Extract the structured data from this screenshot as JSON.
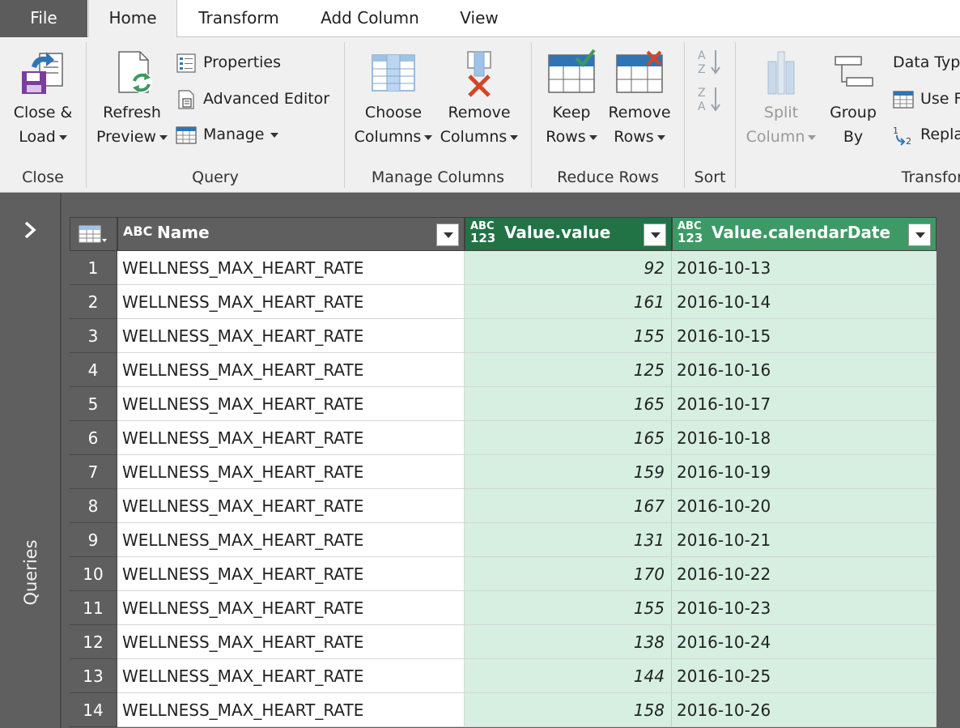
{
  "tabs": [
    "File",
    "Home",
    "Transform",
    "Add Column",
    "View"
  ],
  "ribbon": {
    "close_group": {
      "label": "Close",
      "close_load": [
        "Close &",
        "Load"
      ]
    },
    "query_group": {
      "label": "Query",
      "refresh": [
        "Refresh",
        "Preview"
      ],
      "properties": "Properties",
      "advanced_editor": "Advanced Editor",
      "manage": "Manage"
    },
    "manage_columns_group": {
      "label": "Manage Columns",
      "choose": [
        "Choose",
        "Columns"
      ],
      "remove": [
        "Remove",
        "Columns"
      ]
    },
    "reduce_rows_group": {
      "label": "Reduce Rows",
      "keep": [
        "Keep",
        "Rows"
      ],
      "remove": [
        "Remove",
        "Rows"
      ]
    },
    "sort_group": {
      "label": "Sort"
    },
    "transform_group": {
      "label": "Transfor",
      "split": [
        "Split",
        "Column"
      ],
      "group_by": [
        "Group",
        "By"
      ],
      "data_type": "Data Typ",
      "use_first_row": "Use F",
      "replace": "Repla"
    }
  },
  "queries_pane": {
    "label": "Queries"
  },
  "grid": {
    "columns": [
      {
        "title": "Name",
        "type": "ABC"
      },
      {
        "title": "Value.value",
        "type": "ABC 123"
      },
      {
        "title": "Value.calendarDate",
        "type": "ABC 123"
      }
    ],
    "rows": [
      {
        "n": "1",
        "name": "WELLNESS_MAX_HEART_RATE",
        "value": "92",
        "date": "2016-10-13"
      },
      {
        "n": "2",
        "name": "WELLNESS_MAX_HEART_RATE",
        "value": "161",
        "date": "2016-10-14"
      },
      {
        "n": "3",
        "name": "WELLNESS_MAX_HEART_RATE",
        "value": "155",
        "date": "2016-10-15"
      },
      {
        "n": "4",
        "name": "WELLNESS_MAX_HEART_RATE",
        "value": "125",
        "date": "2016-10-16"
      },
      {
        "n": "5",
        "name": "WELLNESS_MAX_HEART_RATE",
        "value": "165",
        "date": "2016-10-17"
      },
      {
        "n": "6",
        "name": "WELLNESS_MAX_HEART_RATE",
        "value": "165",
        "date": "2016-10-18"
      },
      {
        "n": "7",
        "name": "WELLNESS_MAX_HEART_RATE",
        "value": "159",
        "date": "2016-10-19"
      },
      {
        "n": "8",
        "name": "WELLNESS_MAX_HEART_RATE",
        "value": "167",
        "date": "2016-10-20"
      },
      {
        "n": "9",
        "name": "WELLNESS_MAX_HEART_RATE",
        "value": "131",
        "date": "2016-10-21"
      },
      {
        "n": "10",
        "name": "WELLNESS_MAX_HEART_RATE",
        "value": "170",
        "date": "2016-10-22"
      },
      {
        "n": "11",
        "name": "WELLNESS_MAX_HEART_RATE",
        "value": "155",
        "date": "2016-10-23"
      },
      {
        "n": "12",
        "name": "WELLNESS_MAX_HEART_RATE",
        "value": "138",
        "date": "2016-10-24"
      },
      {
        "n": "13",
        "name": "WELLNESS_MAX_HEART_RATE",
        "value": "144",
        "date": "2016-10-25"
      },
      {
        "n": "14",
        "name": "WELLNESS_MAX_HEART_RATE",
        "value": "158",
        "date": "2016-10-26"
      }
    ]
  },
  "colors": {
    "selected_header": "#217346",
    "selected_header_2": "#3d9a66",
    "selected_cells": "#d6efe1",
    "chrome_gray": "#5f5f5f"
  }
}
